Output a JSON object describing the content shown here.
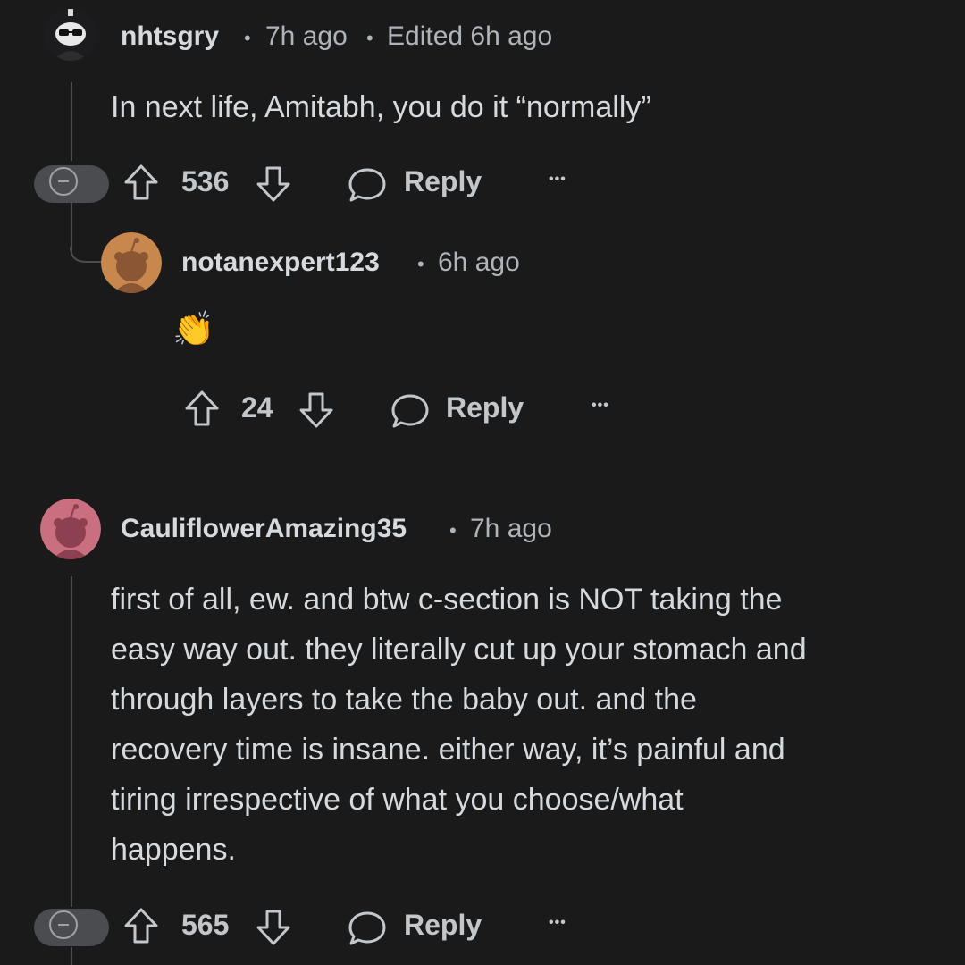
{
  "comments": [
    {
      "username": "nhtsgry",
      "time": "7h ago",
      "edited": "Edited 6h ago",
      "body": "In next life, Amitabh, you do it “normally”",
      "score": "536",
      "reply_label": "Reply",
      "more_label": "•••"
    },
    {
      "username": "notanexpert123",
      "time": "6h ago",
      "body_emoji": "👏",
      "score": "24",
      "reply_label": "Reply",
      "more_label": "•••"
    },
    {
      "username": "CauliflowerAmazing35",
      "time": "7h ago",
      "body_lines": [
        "first of all, ew. and btw c-section is NOT taking the",
        "easy way out. they literally cut up your stomach and",
        "through layers to take the baby out. and the",
        "recovery time is insane. either way, it’s painful and",
        "tiring irrespective of what you choose/what",
        "happens."
      ],
      "score": "565",
      "reply_label": "Reply",
      "more_label": "•••"
    }
  ],
  "separator": "•",
  "colors": {
    "background": "#1a1a1b",
    "text": "#d7dadc",
    "meta": "#b0b3b8",
    "thread_line": "#4a4c4f",
    "avatar2_bg": "#c8874d",
    "avatar3_bg": "#c96f80"
  }
}
